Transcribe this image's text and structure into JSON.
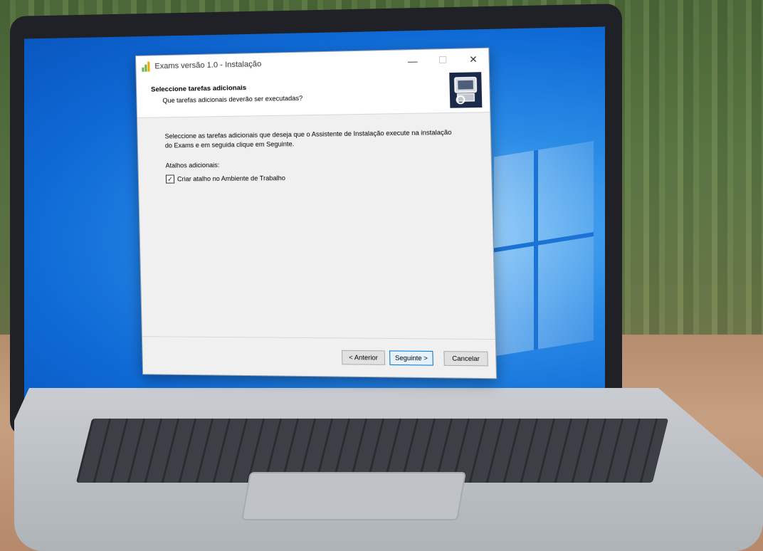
{
  "window": {
    "title": "Exams versão 1.0 - Instalação",
    "minimize_glyph": "—",
    "maximize_glyph": "☐",
    "close_glyph": "✕",
    "app_icon": "bar-chart-icon"
  },
  "header": {
    "title": "Seleccione tarefas adicionais",
    "subtitle": "Que tarefas adicionais deverão ser executadas?",
    "image_icon": "installer-computer-icon"
  },
  "content": {
    "description": "Seleccione as tarefas adicionais que deseja que o Assistente de Instalação execute na instalação do Exams e em seguida clique em Seguinte.",
    "section_label": "Atalhos adicionais:",
    "checkbox": {
      "label": "Criar atalho no Ambiente de Trabalho",
      "checked": true,
      "check_glyph": "✓"
    }
  },
  "footer": {
    "back_label": "< Anterior",
    "next_label": "Seguinte >",
    "cancel_label": "Cancelar"
  },
  "colors": {
    "desktop_blue": "#0f6ad6",
    "primary_button_border": "#0078d7"
  }
}
